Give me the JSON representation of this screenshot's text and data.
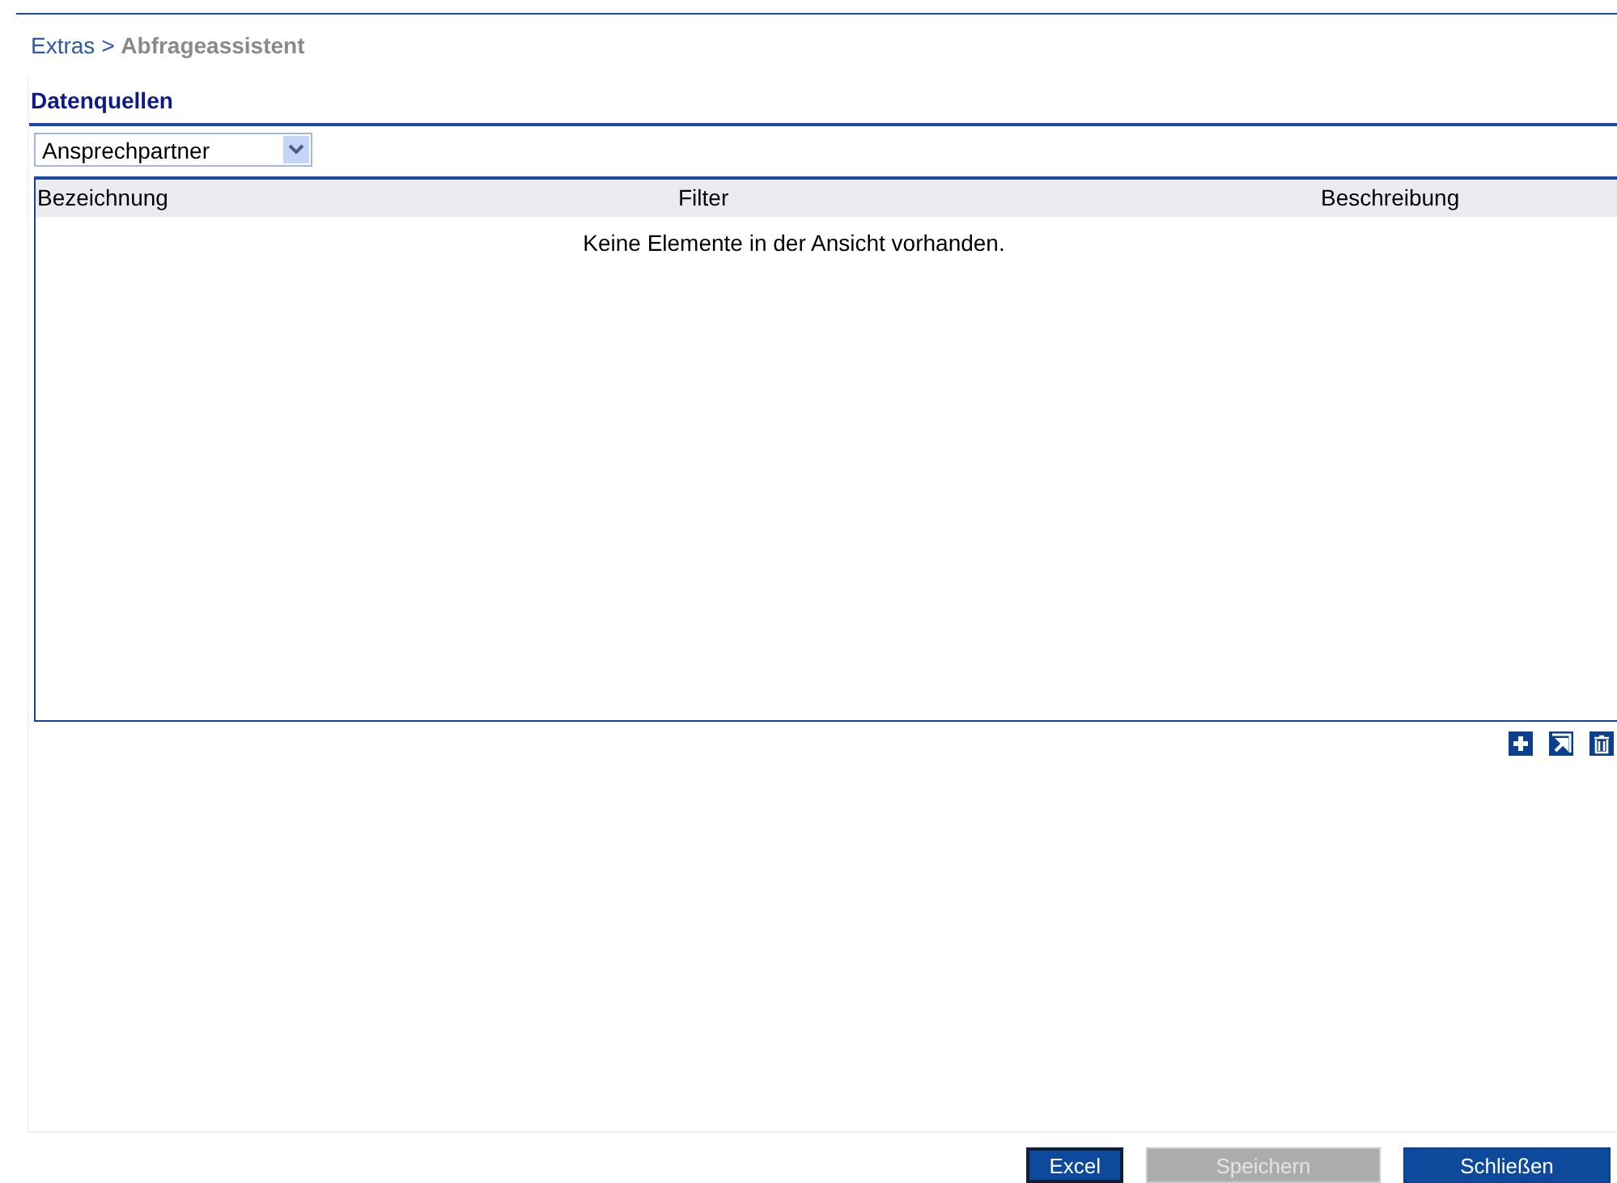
{
  "breadcrumb": {
    "parent": "Extras",
    "separator": ">",
    "current": "Abfrageassistent"
  },
  "panel": {
    "title": "Datenquellen",
    "datasource_select": {
      "value": "Ansprechpartner"
    },
    "table": {
      "columns": [
        "Bezeichnung",
        "Filter",
        "Beschreibung"
      ],
      "empty_message": "Keine Elemente in der Ansicht vorhanden."
    },
    "toolbar": [
      {
        "kind": "add"
      },
      {
        "kind": "open"
      },
      {
        "kind": "delete"
      }
    ]
  },
  "buttons": [
    {
      "label": "Excel",
      "focused": true,
      "disabled": false
    },
    {
      "label": "Speichern",
      "focused": false,
      "disabled": true
    },
    {
      "label": "Schließen",
      "focused": false,
      "disabled": false
    }
  ]
}
